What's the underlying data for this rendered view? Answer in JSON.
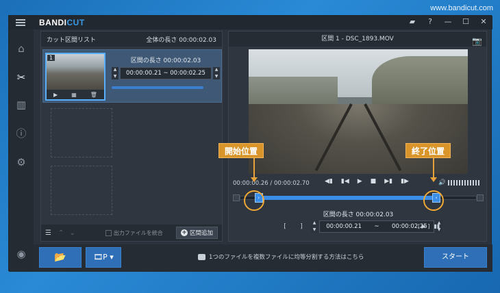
{
  "watermark": "www.bandicut.com",
  "app": {
    "logo_a": "BANDI",
    "logo_b": "CUT"
  },
  "titlebar_icons": [
    "folder-icon",
    "help-icon",
    "minimize-icon",
    "maximize-icon",
    "close-icon"
  ],
  "titlebar_glyphs": {
    "folder": "▰",
    "help": "?",
    "min": "—",
    "max": "☐",
    "close": "✕"
  },
  "sidebar": [
    "home-icon",
    "cut-icon",
    "film-icon",
    "info-icon",
    "settings-icon",
    "record-icon"
  ],
  "sidebar_glyphs": {
    "home": "⌂",
    "cut": "✂",
    "film": "▥",
    "info": "ⓘ",
    "settings": "⚙",
    "record": "◉"
  },
  "left_panel": {
    "title": "カット区間リスト",
    "total_length": "全体の長さ 00:00:02.03",
    "clip": {
      "number": "1",
      "length": "区間の長さ 00:00:02.03",
      "range": "00:00:00.21 ~ 00:00:02.25",
      "progress": 0.85
    },
    "footer": {
      "merge_label": "出力ファイルを統合",
      "add_label": "区間追加"
    }
  },
  "right_panel": {
    "title": "区間 1 - DSC_1893.MOV",
    "time_display": "00:00:00.26 / 00:00:02.70",
    "segment_length": "区間の長さ 00:00:02.03",
    "range_start": "00:00:00.21",
    "range_sep": "~",
    "range_end": "00:00:02.25",
    "bracket_open": "[",
    "bracket_close": "]",
    "play_mark": "[ ▶ ]",
    "selection_start": 0.08,
    "selection_end": 0.83
  },
  "annotations": {
    "start": "開始位置",
    "end": "終了位置"
  },
  "bottom": {
    "hint": "1つのファイルを複数ファイルに均等分割する方法はこちら",
    "start_button": "スタート",
    "format_label": "🎞P ▾",
    "open_glyph": "📂"
  }
}
